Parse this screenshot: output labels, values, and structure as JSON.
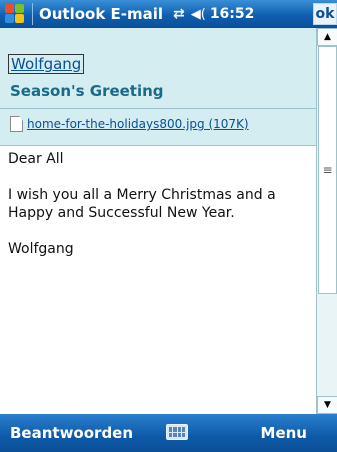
{
  "titlebar": {
    "app_title": "Outlook E-mail",
    "clock": "16:52",
    "ok_label": "ok",
    "connectivity_icon": "connectivity-icon",
    "volume_icon": "speaker-icon"
  },
  "header": {
    "from": "Wolfgang",
    "subject": "Season's Greeting",
    "attachment": "home-for-the-holidays800.jpg (107K)"
  },
  "body": {
    "greeting": "Dear All",
    "message": "I wish you all a Merry Christmas and a Happy and Successful New Year.",
    "signature": "Wolfgang"
  },
  "bottombar": {
    "left_softkey": "Beantwoorden",
    "right_softkey": "Menu"
  },
  "colors": {
    "titlebar": "#0f5fb0",
    "header_bg": "#d4edf1",
    "subject": "#1a6a8a",
    "link": "#0a4f98"
  }
}
